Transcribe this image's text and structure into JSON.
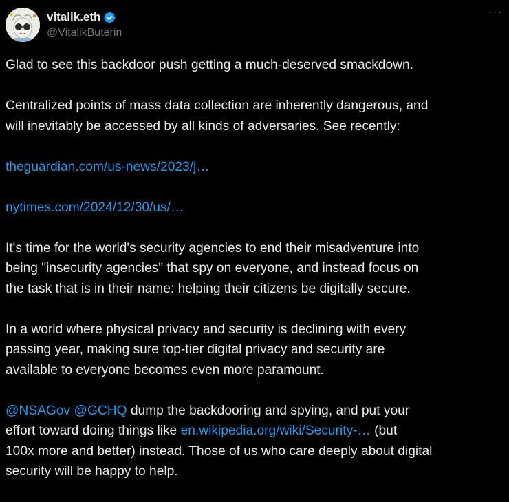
{
  "author": {
    "display_name": "vitalik.eth",
    "handle": "@VitalikButerin",
    "verified_icon": "verified-badge-icon",
    "avatar_icon": "avatar"
  },
  "menu": {
    "more_label": "···"
  },
  "colors": {
    "background": "#000000",
    "text": "#e7e9ea",
    "secondary_text": "#71767b",
    "link": "#1d9bf0",
    "verified": "#1d9bf0"
  },
  "tweet": {
    "p1": "Glad to see this backdoor push getting a much-deserved smackdown.",
    "p2_line1": "Centralized points of mass data collection are inherently dangerous, and",
    "p2_line2": "will inevitably be accessed by all kinds of adversaries. See recently:",
    "link1": "theguardian.com/us-news/2023/j…",
    "link2": "nytimes.com/2024/12/30/us/…",
    "p3_line1": "It's time for the world's security agencies to end their misadventure into",
    "p3_line2": "being \"insecurity agencies\" that spy on everyone, and instead focus on",
    "p3_line3": "the task that is in their name: helping their citizens be digitally secure.",
    "p4_line1": "In a world where physical privacy and security is declining with every",
    "p4_line2": "passing year, making sure top-tier digital privacy and security are",
    "p4_line3": "available to everyone becomes even more paramount.",
    "mention1": "@NSAGov",
    "mention2": "@GCHQ",
    "p5_line1_rest": " dump the backdooring and spying, and put your",
    "p5_line2_start": "effort toward doing things like ",
    "link3": "en.wikipedia.org/wiki/Security-…",
    "p5_line2_end": " (but",
    "p5_line3": "100x more and better) instead. Those of us who care deeply about digital",
    "p5_line4": "security will be happy to help."
  }
}
